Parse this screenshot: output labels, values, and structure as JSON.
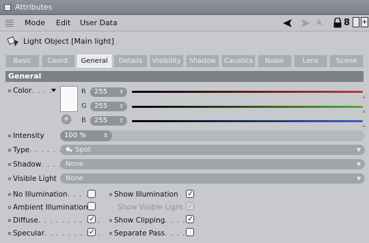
{
  "window": {
    "title": "Attributes"
  },
  "menubar": {
    "items": [
      "Mode",
      "Edit",
      "User Data"
    ],
    "lock_count": "8"
  },
  "object": {
    "title": "Light Object [Main light]"
  },
  "tabs": [
    "Basic",
    "Coord.",
    "General",
    "Details",
    "Visibility",
    "Shadow",
    "Caustics",
    "Noise",
    "Lens",
    "Scene"
  ],
  "active_tab": "General",
  "section": "General",
  "color": {
    "label": "Color",
    "dots": ". . . .",
    "swatch_hex": "#fafafa",
    "channels": [
      {
        "name": "R",
        "value": "255",
        "gradient_end": "#b93a3a"
      },
      {
        "name": "G",
        "value": "255",
        "gradient_end": "#5aa83a"
      },
      {
        "name": "B",
        "value": "255",
        "gradient_end": "#3a5ec0"
      }
    ],
    "add_button": "+"
  },
  "intensity": {
    "label": "Intensity",
    "value": "100 %"
  },
  "type": {
    "label": "Type",
    "dots": ". . . . . . .",
    "value": "Spot"
  },
  "shadow": {
    "label": "Shadow",
    "dots": ". . . .",
    "value": "None"
  },
  "visible_light": {
    "label": "Visible Light",
    "value": "None"
  },
  "options_left": [
    {
      "label": "No Illumination",
      "dots": ". . . . .",
      "checked": false
    },
    {
      "label": "Ambient Illumination",
      "dots": "",
      "checked": false
    },
    {
      "label": "Diffuse",
      "dots": ". . . . . . . . . . .",
      "checked": true
    },
    {
      "label": "Specular",
      "dots": ". . . . . . . . . .",
      "checked": true
    }
  ],
  "options_right": [
    {
      "label": "Show Illumination",
      "dots": "",
      "checked": true,
      "disabled": false
    },
    {
      "label": "Show Visible Light",
      "dots": "",
      "checked": true,
      "disabled": true
    },
    {
      "label": "Show Clipping",
      "dots": ". . . .",
      "checked": true,
      "disabled": false
    },
    {
      "label": "Separate Pass",
      "dots": ". . . .",
      "checked": false,
      "disabled": false
    }
  ]
}
